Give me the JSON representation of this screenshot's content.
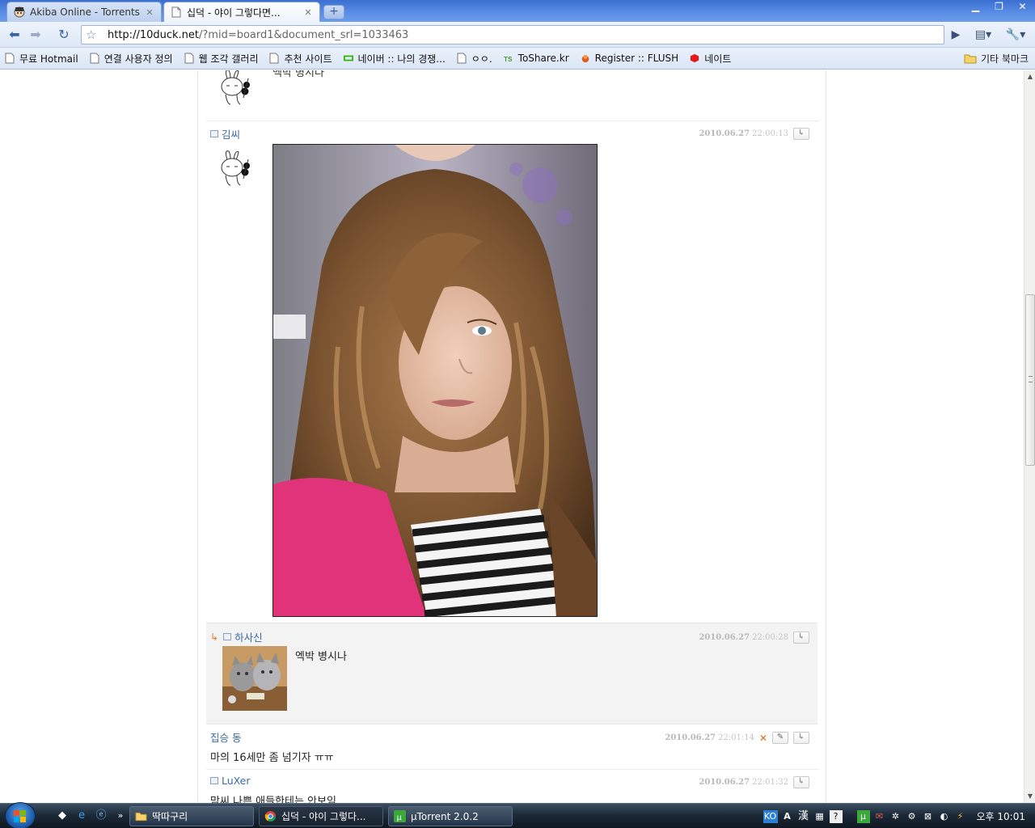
{
  "browser": {
    "tabs": [
      {
        "title": "Akiba Online - Torrents",
        "active": false
      },
      {
        "title": "십덕 - 야이 그렇다면...",
        "active": true
      }
    ],
    "url_host": "http://10duck.net",
    "url_path": "/?mid=board1&document_srl=1033463",
    "bookmarks": [
      "무료 Hotmail",
      "연결 사용자 정의",
      "웹 조각 갤러리",
      "추천 사이트",
      "네이버 :: 나의 경쟁...",
      "ㅇㅇ.",
      "ToShare.kr",
      "Register :: FLUSH",
      "네이트"
    ],
    "other_bookmarks": "기타 북마크"
  },
  "page": {
    "cut_text": "엑박 병시나",
    "comments": [
      {
        "author": "김씨",
        "date": "2010.06.27",
        "time": "22:00:13"
      },
      {
        "author": "하사신",
        "date": "2010.06.27",
        "time": "22:00:28",
        "text": "엑박 병시나",
        "is_reply": true
      },
      {
        "author": "집승 동",
        "date": "2010.06.27",
        "time": "22:01:14",
        "text": "마의 16세만 좀 넘기자 ㅠㅠ"
      },
      {
        "author": "LuXer",
        "date": "2010.06.27",
        "time": "22:01:32",
        "text": "맘씨 나쁜 애들한테는 안보임"
      }
    ],
    "reply_symbol": "↳"
  },
  "taskbar": {
    "buttons": [
      "딱따구리",
      "십덕 - 야이 그렇다...",
      "µTorrent 2.0.2"
    ],
    "tray_ime": "KO",
    "tray_hanja": "漢",
    "clock": "오후 10:01"
  },
  "colors": {
    "accent": "#3a6aa8",
    "reply_bg": "#f3f3f3",
    "delete_x": "#e06a1c"
  }
}
